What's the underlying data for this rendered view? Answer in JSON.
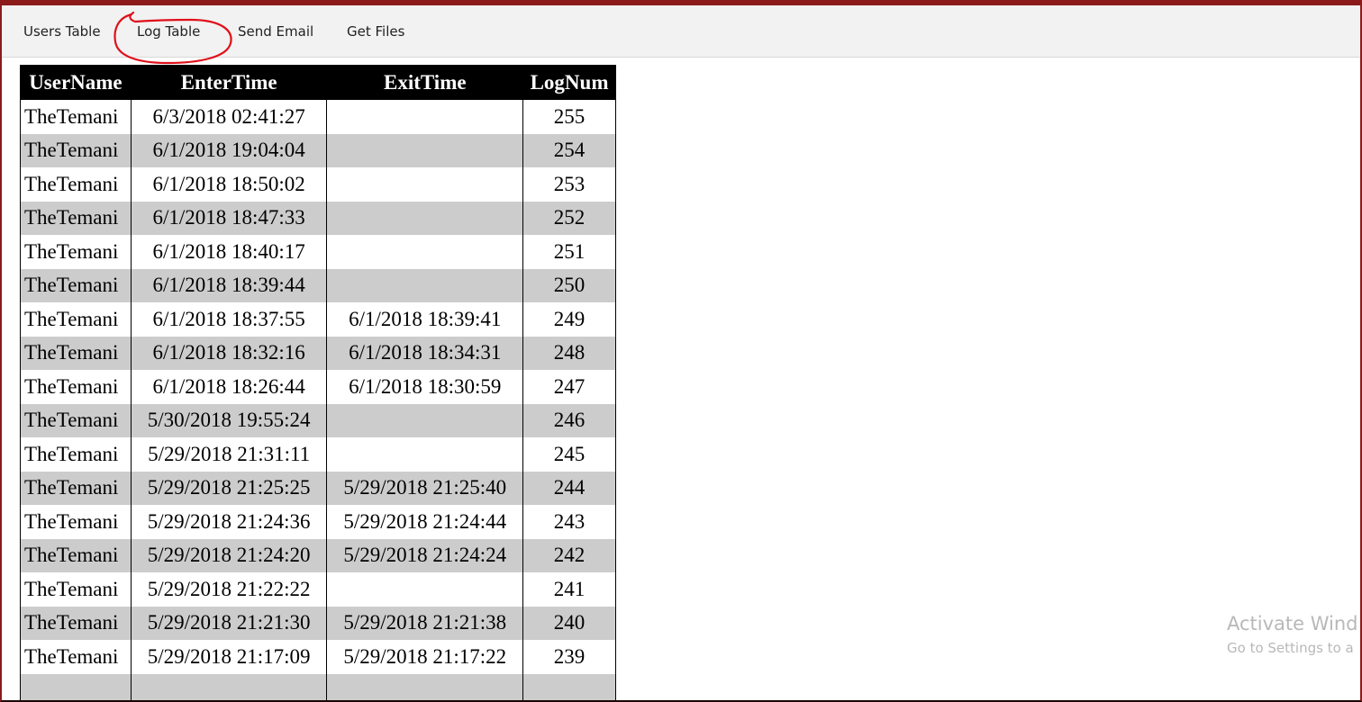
{
  "nav": {
    "items": [
      {
        "label": "Users Table"
      },
      {
        "label": "Log Table"
      },
      {
        "label": "Send Email"
      },
      {
        "label": "Get Files"
      }
    ]
  },
  "annotation_color": "#e0101a",
  "table": {
    "headers": [
      "UserName",
      "EnterTime",
      "ExitTime",
      "LogNum"
    ],
    "rows": [
      [
        "TheTemani",
        "6/3/2018 02:41:27",
        "",
        "255"
      ],
      [
        "TheTemani",
        "6/1/2018 19:04:04",
        "",
        "254"
      ],
      [
        "TheTemani",
        "6/1/2018 18:50:02",
        "",
        "253"
      ],
      [
        "TheTemani",
        "6/1/2018 18:47:33",
        "",
        "252"
      ],
      [
        "TheTemani",
        "6/1/2018 18:40:17",
        "",
        "251"
      ],
      [
        "TheTemani",
        "6/1/2018 18:39:44",
        "",
        "250"
      ],
      [
        "TheTemani",
        "6/1/2018 18:37:55",
        "6/1/2018 18:39:41",
        "249"
      ],
      [
        "TheTemani",
        "6/1/2018 18:32:16",
        "6/1/2018 18:34:31",
        "248"
      ],
      [
        "TheTemani",
        "6/1/2018 18:26:44",
        "6/1/2018 18:30:59",
        "247"
      ],
      [
        "TheTemani",
        "5/30/2018 19:55:24",
        "",
        "246"
      ],
      [
        "TheTemani",
        "5/29/2018 21:31:11",
        "",
        "245"
      ],
      [
        "TheTemani",
        "5/29/2018 21:25:25",
        "5/29/2018 21:25:40",
        "244"
      ],
      [
        "TheTemani",
        "5/29/2018 21:24:36",
        "5/29/2018 21:24:44",
        "243"
      ],
      [
        "TheTemani",
        "5/29/2018 21:24:20",
        "5/29/2018 21:24:24",
        "242"
      ],
      [
        "TheTemani",
        "5/29/2018 21:22:22",
        "",
        "241"
      ],
      [
        "TheTemani",
        "5/29/2018 21:21:30",
        "5/29/2018 21:21:38",
        "240"
      ],
      [
        "TheTemani",
        "5/29/2018 21:17:09",
        "5/29/2018 21:17:22",
        "239"
      ]
    ]
  },
  "watermark": {
    "title": "Activate Wind",
    "subtitle": "Go to Settings to a"
  }
}
